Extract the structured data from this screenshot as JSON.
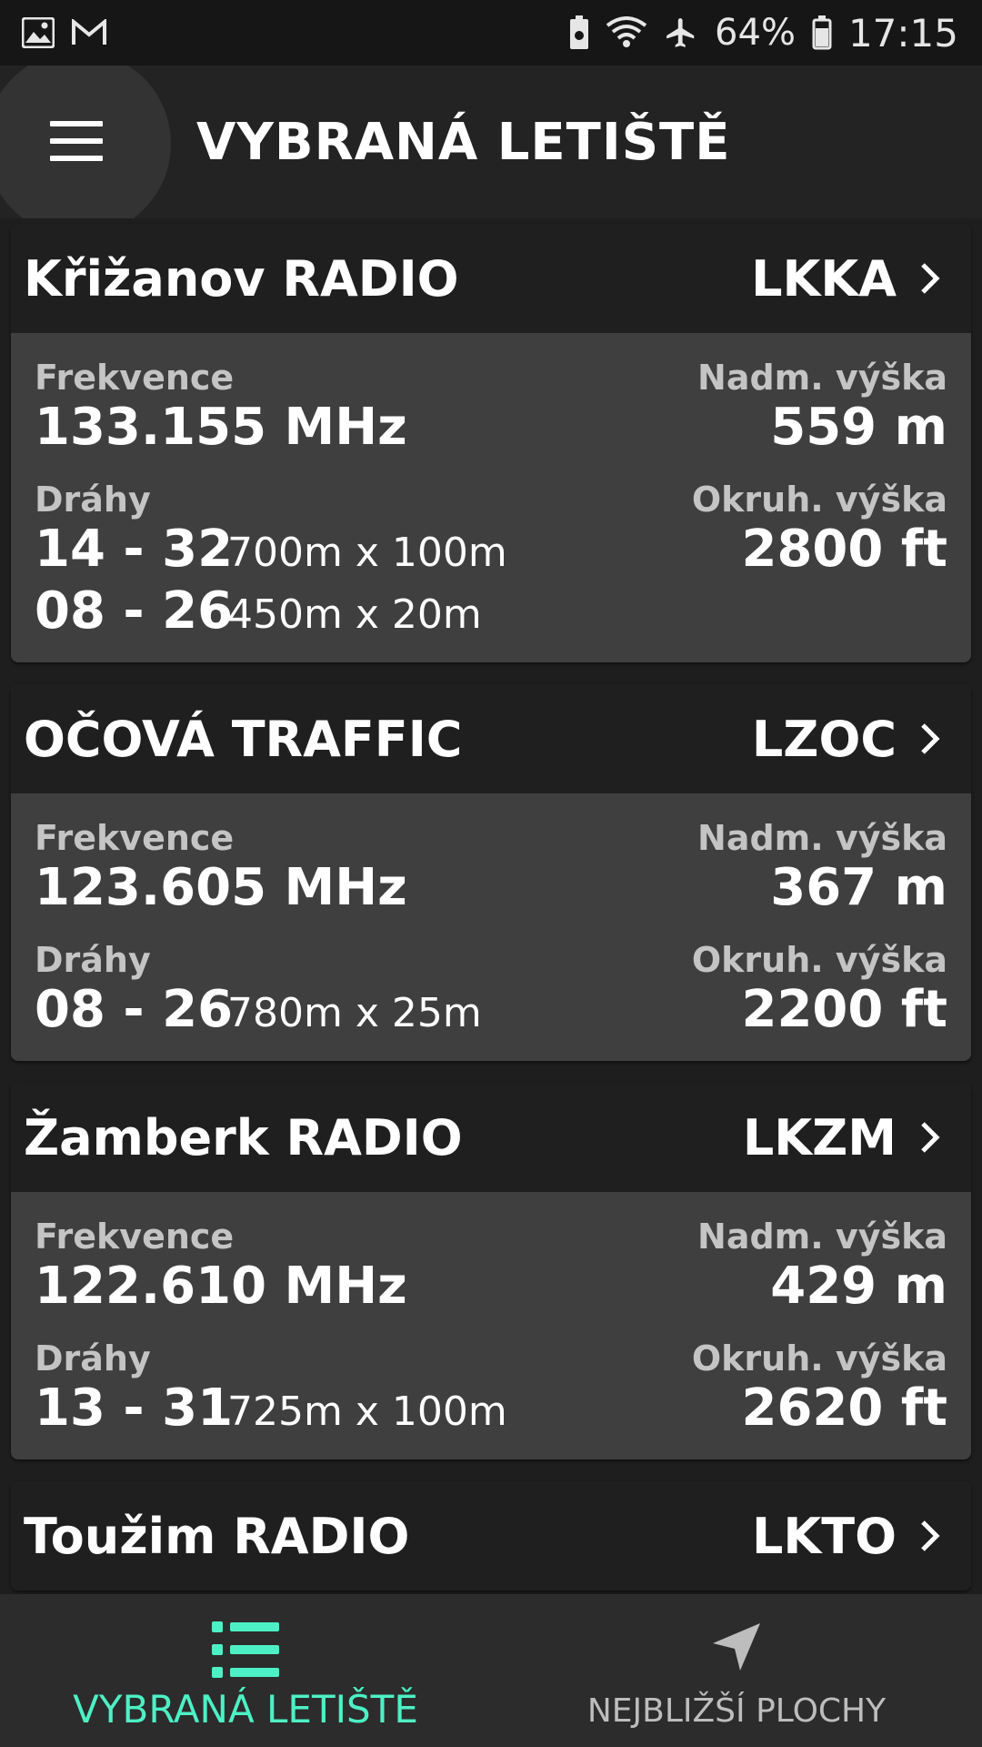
{
  "status": {
    "battery": "64%",
    "time": "17:15"
  },
  "appbar": {
    "title": "VYBRANÁ LETIŠTĚ"
  },
  "labels": {
    "frequency": "Frekvence",
    "elevation": "Nadm. výška",
    "runways": "Dráhy",
    "circuit": "Okruh. výška"
  },
  "airports": [
    {
      "name": "Křižanov RADIO",
      "code": "LKKA",
      "frequency": "133.155 MHz",
      "elevation": "559 m",
      "circuit": "2800 ft",
      "runways": [
        {
          "id": "14 - 32",
          "size": "700m x 100m"
        },
        {
          "id": "08 - 26",
          "size": "450m x 20m"
        }
      ]
    },
    {
      "name": "OČOVÁ TRAFFIC",
      "code": "LZOC",
      "frequency": "123.605 MHz",
      "elevation": "367 m",
      "circuit": "2200 ft",
      "runways": [
        {
          "id": "08 - 26",
          "size": "780m x 25m"
        }
      ]
    },
    {
      "name": "Žamberk RADIO",
      "code": "LKZM",
      "frequency": "122.610 MHz",
      "elevation": "429 m",
      "circuit": "2620 ft",
      "runways": [
        {
          "id": "13 - 31",
          "size": "725m x 100m"
        }
      ]
    },
    {
      "name": "Toužim RADIO",
      "code": "LKTO"
    }
  ],
  "bottom_nav": [
    {
      "label": "VYBRANÁ LETIŠTĚ",
      "icon": "list-icon",
      "active": true
    },
    {
      "label": "NEJBLIŽŠÍ PLOCHY",
      "icon": "navigation-arrow-icon",
      "active": false
    }
  ],
  "colors": {
    "accent": "#4df0c5",
    "card": "#3f3f3f",
    "card_header": "#1f1f1f"
  }
}
